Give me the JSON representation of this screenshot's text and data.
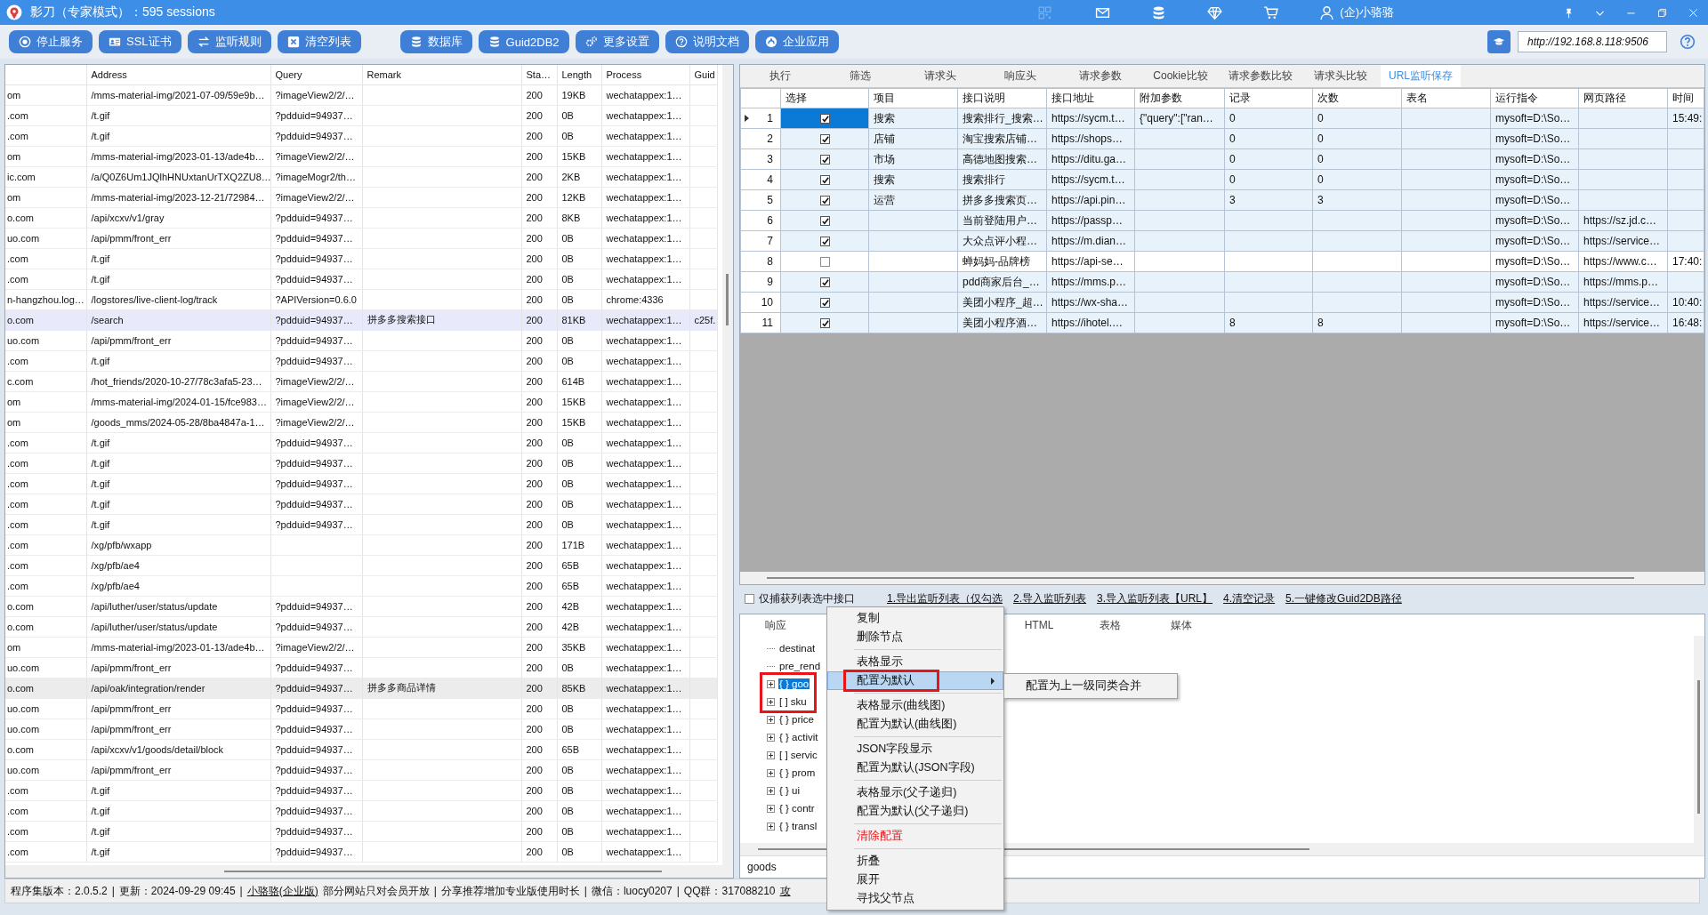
{
  "window": {
    "title": "影刀（专家模式）：595 sessions",
    "user": "(企)小骆骆"
  },
  "toolbar": {
    "groups": [
      [
        "停止服务",
        "SSL证书",
        "监听规则",
        "清空列表"
      ],
      [
        "数据库",
        "Guid2DB2",
        "更多设置",
        "说明文档",
        "企业应用"
      ]
    ],
    "url": "http://192.168.8.118:9506"
  },
  "sessions": {
    "columns": [
      null,
      "Address",
      "Query",
      "Remark",
      "Sta…",
      "Length",
      "Process",
      "Guid"
    ],
    "rows": [
      {
        "cells": [
          "om",
          "/mms-material-img/2021-07-09/59e9b…",
          "?imageView2/2/…",
          null,
          "200",
          "19KB",
          "wechatappex:1…",
          null
        ],
        "selected": false,
        "hovered": false
      },
      {
        "cells": [
          ".com",
          "/t.gif",
          "?pdduid=94937…",
          null,
          "200",
          "0B",
          "wechatappex:1…",
          null
        ],
        "selected": false,
        "hovered": false
      },
      {
        "cells": [
          ".com",
          "/t.gif",
          "?pdduid=94937…",
          null,
          "200",
          "0B",
          "wechatappex:1…",
          null
        ],
        "selected": false,
        "hovered": false
      },
      {
        "cells": [
          "om",
          "/mms-material-img/2023-01-13/ade4b…",
          "?imageView2/2/…",
          null,
          "200",
          "15KB",
          "wechatappex:1…",
          null
        ],
        "selected": false,
        "hovered": false
      },
      {
        "cells": [
          "ic.com",
          "/a/Q0Z6Um1JQlhHNUxtanUrTXQ2ZU8…",
          "?imageMogr2/th…",
          null,
          "200",
          "2KB",
          "wechatappex:1…",
          null
        ],
        "selected": false,
        "hovered": false
      },
      {
        "cells": [
          "om",
          "/mms-material-img/2023-12-21/72984…",
          "?imageView2/2/…",
          null,
          "200",
          "12KB",
          "wechatappex:1…",
          null
        ],
        "selected": false,
        "hovered": false
      },
      {
        "cells": [
          "o.com",
          "/api/xcxv/v1/gray",
          "?pdduid=94937…",
          null,
          "200",
          "8KB",
          "wechatappex:1…",
          null
        ],
        "selected": false,
        "hovered": false
      },
      {
        "cells": [
          "uo.com",
          "/api/pmm/front_err",
          "?pdduid=94937…",
          null,
          "200",
          "0B",
          "wechatappex:1…",
          null
        ],
        "selected": false,
        "hovered": false
      },
      {
        "cells": [
          ".com",
          "/t.gif",
          "?pdduid=94937…",
          null,
          "200",
          "0B",
          "wechatappex:1…",
          null
        ],
        "selected": false,
        "hovered": false
      },
      {
        "cells": [
          ".com",
          "/t.gif",
          "?pdduid=94937…",
          null,
          "200",
          "0B",
          "wechatappex:1…",
          null
        ],
        "selected": false,
        "hovered": false
      },
      {
        "cells": [
          "n-hangzhou.log…",
          "/logstores/live-client-log/track",
          "?APIVersion=0.6.0",
          null,
          "200",
          "0B",
          "chrome:4336",
          null
        ],
        "selected": false,
        "hovered": false
      },
      {
        "cells": [
          "o.com",
          "/search",
          "?pdduid=94937…",
          "拼多多搜索接口",
          "200",
          "81KB",
          "wechatappex:1…",
          "c25f."
        ],
        "selected": true,
        "hovered": false
      },
      {
        "cells": [
          "uo.com",
          "/api/pmm/front_err",
          "?pdduid=94937…",
          null,
          "200",
          "0B",
          "wechatappex:1…",
          null
        ],
        "selected": false,
        "hovered": false
      },
      {
        "cells": [
          ".com",
          "/t.gif",
          "?pdduid=94937…",
          null,
          "200",
          "0B",
          "wechatappex:1…",
          null
        ],
        "selected": false,
        "hovered": false
      },
      {
        "cells": [
          "c.com",
          "/hot_friends/2020-10-27/78c3afa5-23…",
          "?imageView2/2/…",
          null,
          "200",
          "614B",
          "wechatappex:1…",
          null
        ],
        "selected": false,
        "hovered": false
      },
      {
        "cells": [
          "om",
          "/mms-material-img/2024-01-15/fce983…",
          "?imageView2/2/…",
          null,
          "200",
          "15KB",
          "wechatappex:1…",
          null
        ],
        "selected": false,
        "hovered": false
      },
      {
        "cells": [
          "om",
          "/goods_mms/2024-05-28/8ba4847a-1…",
          "?imageView2/2/…",
          null,
          "200",
          "15KB",
          "wechatappex:1…",
          null
        ],
        "selected": false,
        "hovered": false
      },
      {
        "cells": [
          ".com",
          "/t.gif",
          "?pdduid=94937…",
          null,
          "200",
          "0B",
          "wechatappex:1…",
          null
        ],
        "selected": false,
        "hovered": false
      },
      {
        "cells": [
          ".com",
          "/t.gif",
          "?pdduid=94937…",
          null,
          "200",
          "0B",
          "wechatappex:1…",
          null
        ],
        "selected": false,
        "hovered": false
      },
      {
        "cells": [
          ".com",
          "/t.gif",
          "?pdduid=94937…",
          null,
          "200",
          "0B",
          "wechatappex:1…",
          null
        ],
        "selected": false,
        "hovered": false
      },
      {
        "cells": [
          ".com",
          "/t.gif",
          "?pdduid=94937…",
          null,
          "200",
          "0B",
          "wechatappex:1…",
          null
        ],
        "selected": false,
        "hovered": false
      },
      {
        "cells": [
          ".com",
          "/t.gif",
          "?pdduid=94937…",
          null,
          "200",
          "0B",
          "wechatappex:1…",
          null
        ],
        "selected": false,
        "hovered": false
      },
      {
        "cells": [
          ".com",
          "/xg/pfb/wxapp",
          null,
          null,
          "200",
          "171B",
          "wechatappex:1…",
          null
        ],
        "selected": false,
        "hovered": false
      },
      {
        "cells": [
          ".com",
          "/xg/pfb/ae4",
          null,
          null,
          "200",
          "65B",
          "wechatappex:1…",
          null
        ],
        "selected": false,
        "hovered": false
      },
      {
        "cells": [
          ".com",
          "/xg/pfb/ae4",
          null,
          null,
          "200",
          "65B",
          "wechatappex:1…",
          null
        ],
        "selected": false,
        "hovered": false
      },
      {
        "cells": [
          "o.com",
          "/api/luther/user/status/update",
          "?pdduid=94937…",
          null,
          "200",
          "42B",
          "wechatappex:1…",
          null
        ],
        "selected": false,
        "hovered": false
      },
      {
        "cells": [
          "o.com",
          "/api/luther/user/status/update",
          "?pdduid=94937…",
          null,
          "200",
          "42B",
          "wechatappex:1…",
          null
        ],
        "selected": false,
        "hovered": false
      },
      {
        "cells": [
          "om",
          "/mms-material-img/2023-01-13/ade4b…",
          "?imageView2/2/…",
          null,
          "200",
          "35KB",
          "wechatappex:1…",
          null
        ],
        "selected": false,
        "hovered": false
      },
      {
        "cells": [
          "uo.com",
          "/api/pmm/front_err",
          "?pdduid=94937…",
          null,
          "200",
          "0B",
          "wechatappex:1…",
          null
        ],
        "selected": false,
        "hovered": false
      },
      {
        "cells": [
          "o.com",
          "/api/oak/integration/render",
          "?pdduid=94937…",
          "拼多多商品详情",
          "200",
          "85KB",
          "wechatappex:1…",
          null
        ],
        "selected": false,
        "hovered": true
      },
      {
        "cells": [
          "uo.com",
          "/api/pmm/front_err",
          "?pdduid=94937…",
          null,
          "200",
          "0B",
          "wechatappex:1…",
          null
        ],
        "selected": false,
        "hovered": false
      },
      {
        "cells": [
          "uo.com",
          "/api/pmm/front_err",
          "?pdduid=94937…",
          null,
          "200",
          "0B",
          "wechatappex:1…",
          null
        ],
        "selected": false,
        "hovered": false
      },
      {
        "cells": [
          "o.com",
          "/api/xcxv/v1/goods/detail/block",
          "?pdduid=94937…",
          null,
          "200",
          "65B",
          "wechatappex:1…",
          null
        ],
        "selected": false,
        "hovered": false
      },
      {
        "cells": [
          "uo.com",
          "/api/pmm/front_err",
          "?pdduid=94937…",
          null,
          "200",
          "0B",
          "wechatappex:1…",
          null
        ],
        "selected": false,
        "hovered": false
      },
      {
        "cells": [
          ".com",
          "/t.gif",
          "?pdduid=94937…",
          null,
          "200",
          "0B",
          "wechatappex:1…",
          null
        ],
        "selected": false,
        "hovered": false
      },
      {
        "cells": [
          ".com",
          "/t.gif",
          "?pdduid=94937…",
          null,
          "200",
          "0B",
          "wechatappex:1…",
          null
        ],
        "selected": false,
        "hovered": false
      },
      {
        "cells": [
          ".com",
          "/t.gif",
          "?pdduid=94937…",
          null,
          "200",
          "0B",
          "wechatappex:1…",
          null
        ],
        "selected": false,
        "hovered": false
      },
      {
        "cells": [
          ".com",
          "/t.gif",
          "?pdduid=94937…",
          null,
          "200",
          "0B",
          "wechatappex:1…",
          null
        ],
        "selected": false,
        "hovered": false
      }
    ]
  },
  "detail_tabs": [
    {
      "label": "执行",
      "selected": false
    },
    {
      "label": "筛选",
      "selected": false
    },
    {
      "label": "请求头",
      "selected": false
    },
    {
      "label": "响应头",
      "selected": false
    },
    {
      "label": "请求参数",
      "selected": false
    },
    {
      "label": "Cookie比较",
      "selected": false
    },
    {
      "label": "请求参数比较",
      "selected": false
    },
    {
      "label": "请求头比较",
      "selected": false
    },
    {
      "label": "URL监听保存",
      "selected": true
    }
  ],
  "monitor": {
    "columns": [
      "选择",
      "项目",
      "接口说明",
      "接口地址",
      "附加参数",
      "记录",
      "次数",
      "表名",
      "运行指令",
      "网页路径",
      "时间"
    ],
    "rows": [
      {
        "index": "1",
        "checked": true,
        "selected": true,
        "cells": [
          null,
          "搜索",
          "搜索排行_搜索…",
          "https://sycm.t…",
          "{\"query\":[\"ran…",
          "0",
          "0",
          null,
          "mysoft=D:\\So…",
          null,
          "15:49:"
        ]
      },
      {
        "index": "2",
        "checked": true,
        "selected": false,
        "cells": [
          null,
          "店铺",
          "淘宝搜索店铺…",
          "https://shops…",
          null,
          "0",
          "0",
          null,
          "mysoft=D:\\So…",
          null,
          null
        ]
      },
      {
        "index": "3",
        "checked": true,
        "selected": false,
        "cells": [
          null,
          "市场",
          "高德地图搜索…",
          "https://ditu.ga…",
          null,
          "0",
          "0",
          null,
          "mysoft=D:\\So…",
          null,
          null
        ]
      },
      {
        "index": "4",
        "checked": true,
        "selected": false,
        "cells": [
          null,
          "搜索",
          "搜索排行",
          "https://sycm.t…",
          null,
          "0",
          "0",
          null,
          "mysoft=D:\\So…",
          null,
          null
        ]
      },
      {
        "index": "5",
        "checked": true,
        "selected": false,
        "cells": [
          null,
          "运营",
          "拼多多搜索页…",
          "https://api.pin…",
          null,
          "3",
          "3",
          null,
          "mysoft=D:\\So…",
          null,
          null
        ]
      },
      {
        "index": "6",
        "checked": true,
        "selected": false,
        "cells": [
          null,
          null,
          "当前登陆用户…",
          "https://passp…",
          null,
          null,
          null,
          null,
          "mysoft=D:\\So…",
          "https://sz.jd.c…",
          null
        ]
      },
      {
        "index": "7",
        "checked": true,
        "selected": false,
        "cells": [
          null,
          null,
          "大众点评小程…",
          "https://m.dian…",
          null,
          null,
          null,
          null,
          "mysoft=D:\\So…",
          "https://service…",
          null
        ]
      },
      {
        "index": "8",
        "checked": false,
        "selected": false,
        "cells": [
          null,
          null,
          "蝉妈妈-品牌榜",
          "https://api-se…",
          null,
          null,
          null,
          null,
          "mysoft=D:\\So…",
          "https://www.c…",
          "17:40:"
        ]
      },
      {
        "index": "9",
        "checked": true,
        "selected": false,
        "cells": [
          null,
          null,
          "pdd商家后台_…",
          "https://mms.p…",
          null,
          null,
          null,
          null,
          "mysoft=D:\\So…",
          "https://mms.p…",
          null
        ]
      },
      {
        "index": "10",
        "checked": true,
        "selected": false,
        "cells": [
          null,
          null,
          "美团小程序_超…",
          "https://wx-sha…",
          null,
          null,
          null,
          null,
          "mysoft=D:\\So…",
          "https://service…",
          "10:40:"
        ]
      },
      {
        "index": "11",
        "checked": true,
        "selected": false,
        "cells": [
          null,
          null,
          "美团小程序酒…",
          "https://ihotel.…",
          null,
          "8",
          "8",
          null,
          "mysoft=D:\\So…",
          "https://service…",
          "16:48:"
        ]
      }
    ]
  },
  "capture_options": {
    "only_selected": {
      "label": "仅捕获列表选中接口",
      "checked": false
    },
    "links": [
      "1.导出监听列表（仅勾选",
      "2.导入监听列表",
      "3.导入监听列表【URL】",
      "4.清空记录",
      "5.一键修改Guid2DB路径"
    ]
  },
  "response_tabs": [
    {
      "label": "响应",
      "selected": false
    },
    {
      "label": "HTML",
      "selected": false
    },
    {
      "label": "表格",
      "selected": false
    },
    {
      "label": "媒体",
      "selected": false
    }
  ],
  "tree": [
    {
      "label": "destinat",
      "kind": "leaf",
      "selected": false,
      "highlighted": false
    },
    {
      "label": "pre_rend",
      "kind": "leaf",
      "selected": false,
      "highlighted": false
    },
    {
      "label": "{ } goo",
      "kind": "branch",
      "selected": true,
      "highlighted": true
    },
    {
      "label": "[ ] sku",
      "kind": "branch",
      "selected": false,
      "highlighted": true
    },
    {
      "label": "{ } price",
      "kind": "branch",
      "selected": false,
      "highlighted": false
    },
    {
      "label": "{ } activit",
      "kind": "branch",
      "selected": false,
      "highlighted": false
    },
    {
      "label": "[ ] servic",
      "kind": "branch",
      "selected": false,
      "highlighted": false
    },
    {
      "label": "{ } prom",
      "kind": "branch",
      "selected": false,
      "highlighted": false
    },
    {
      "label": "{ } ui",
      "kind": "branch",
      "selected": false,
      "highlighted": false
    },
    {
      "label": "{ } contr",
      "kind": "branch",
      "selected": false,
      "highlighted": false
    },
    {
      "label": "{ } transl",
      "kind": "branch",
      "selected": false,
      "highlighted": false
    }
  ],
  "search": {
    "value": "goods"
  },
  "context_menu": {
    "items": [
      {
        "kind": "item",
        "label": "复制",
        "hovered": false,
        "highlighted": false,
        "danger": false,
        "submenu": false
      },
      {
        "kind": "item",
        "label": "删除节点",
        "hovered": false,
        "highlighted": false,
        "danger": false,
        "submenu": false
      },
      {
        "kind": "separator"
      },
      {
        "kind": "item",
        "label": "表格显示",
        "hovered": false,
        "highlighted": false,
        "danger": false,
        "submenu": false
      },
      {
        "kind": "item",
        "label": "配置为默认",
        "hovered": true,
        "highlighted": true,
        "danger": false,
        "submenu": true
      },
      {
        "kind": "separator"
      },
      {
        "kind": "item",
        "label": "表格显示(曲线图)",
        "hovered": false,
        "highlighted": false,
        "danger": false,
        "submenu": false
      },
      {
        "kind": "item",
        "label": "配置为默认(曲线图)",
        "hovered": false,
        "highlighted": false,
        "danger": false,
        "submenu": false
      },
      {
        "kind": "separator"
      },
      {
        "kind": "item",
        "label": "JSON字段显示",
        "hovered": false,
        "highlighted": false,
        "danger": false,
        "submenu": false
      },
      {
        "kind": "item",
        "label": "配置为默认(JSON字段)",
        "hovered": false,
        "highlighted": false,
        "danger": false,
        "submenu": false
      },
      {
        "kind": "separator"
      },
      {
        "kind": "item",
        "label": "表格显示(父子递归)",
        "hovered": false,
        "highlighted": false,
        "danger": false,
        "submenu": false
      },
      {
        "kind": "item",
        "label": "配置为默认(父子递归)",
        "hovered": false,
        "highlighted": false,
        "danger": false,
        "submenu": false
      },
      {
        "kind": "separator"
      },
      {
        "kind": "item",
        "label": "清除配置",
        "hovered": false,
        "highlighted": false,
        "danger": true,
        "submenu": false
      },
      {
        "kind": "separator"
      },
      {
        "kind": "item",
        "label": "折叠",
        "hovered": false,
        "highlighted": false,
        "danger": false,
        "submenu": false
      },
      {
        "kind": "item",
        "label": "展开",
        "hovered": false,
        "highlighted": false,
        "danger": false,
        "submenu": false
      },
      {
        "kind": "item",
        "label": "寻找父节点",
        "hovered": false,
        "highlighted": false,
        "danger": false,
        "submenu": false
      }
    ],
    "submenu": [
      "配置为上一级同类合并"
    ]
  },
  "status_bar": [
    {
      "kind": "text",
      "text": "程序集版本：2.0.5.2"
    },
    {
      "kind": "text",
      "text": "|"
    },
    {
      "kind": "text",
      "text": "更新：2024-09-29 09:45"
    },
    {
      "kind": "text",
      "text": "|"
    },
    {
      "kind": "link",
      "text": "小骆骆(企业版)"
    },
    {
      "kind": "text",
      "text": "部分网站只对会员开放"
    },
    {
      "kind": "text",
      "text": "|"
    },
    {
      "kind": "text",
      "text": "分享推荐增加专业版使用时长"
    },
    {
      "kind": "text",
      "text": "|"
    },
    {
      "kind": "text",
      "text": "微信：luocy0207"
    },
    {
      "kind": "text",
      "text": "|"
    },
    {
      "kind": "text",
      "text": "QQ群：317088210"
    },
    {
      "kind": "link",
      "text": "攻"
    }
  ]
}
